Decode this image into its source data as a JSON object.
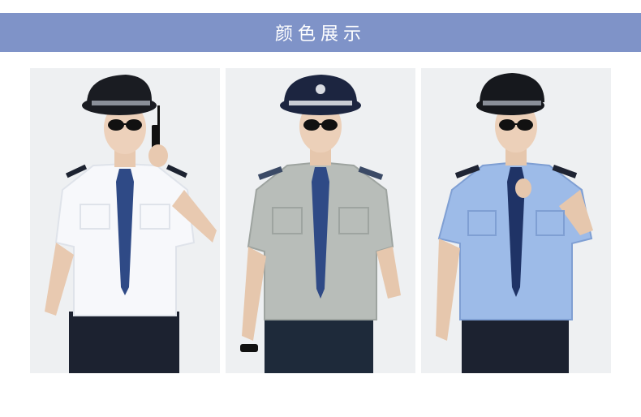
{
  "header": {
    "title": "颜色展示"
  },
  "colors": {
    "banner": "#7f93c8",
    "background": "#ffffff",
    "panel_bg": "#eef0f2"
  },
  "items": [
    {
      "shirt_color": "#f7f8fb",
      "shirt_shade": "#dfe3ea",
      "tie_color": "#2f4a86",
      "trouser_color": "#1c2230",
      "cap_color": "#1a1c22",
      "pose": "radio"
    },
    {
      "shirt_color": "#b8bdb9",
      "shirt_shade": "#9ea4a0",
      "tie_color": "#2f4a86",
      "trouser_color": "#1e2a3a",
      "cap_color": "#1c2540",
      "pose": "standing"
    },
    {
      "shirt_color": "#9dbbe8",
      "shirt_shade": "#7f9fd3",
      "tie_color": "#1f3366",
      "trouser_color": "#1c2230",
      "cap_color": "#16181d",
      "pose": "tie"
    }
  ]
}
